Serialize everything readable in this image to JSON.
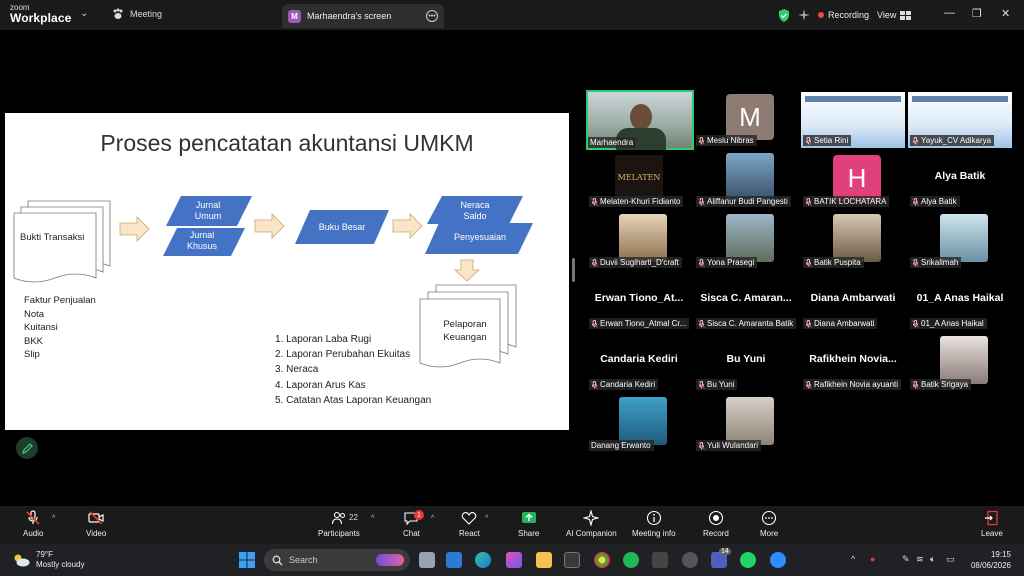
{
  "app": {
    "brand_top": "zoom",
    "brand_bottom": "Workplace",
    "meeting_tab": "Meeting",
    "screen_tab": "Marhaendra's screen",
    "screen_tab_badge": "M",
    "recording_label": "Recording",
    "view_label": "View"
  },
  "slide": {
    "title": "Proses pencatatan akuntansi UMKM",
    "doc_stack_label": "Bukti Transaksi",
    "left_list": [
      "Faktur Penjualan",
      "Nota",
      "Kuitansi",
      "BKK",
      "Slip"
    ],
    "jurnal_umum": [
      "Jurnal",
      "Umum"
    ],
    "jurnal_khusus": [
      "Jurnal",
      "Khusus"
    ],
    "buku_besar": "Buku Besar",
    "neraca_saldo": [
      "Neraca",
      "Saldo"
    ],
    "penyesuaian": "Penyesuaian",
    "pelaporan": [
      "Pelaporan",
      "Keuangan"
    ],
    "report_list": [
      "1. Laporan Laba Rugi",
      "2. Laporan Perubahan Ekuitas",
      "3. Neraca",
      "4. Laporan Arus Kas",
      "5. Catatan Atas Laporan Keuangan"
    ],
    "colors": {
      "shape_blue": "#4472c4",
      "arrow_fill": "#fbe5c8",
      "arrow_stroke": "#c9a66b"
    }
  },
  "gallery": [
    {
      "name": "Marhaendra",
      "kind": "video",
      "muted": false,
      "active": true
    },
    {
      "name": "Meslu Nibras",
      "kind": "letter",
      "letter": "M",
      "color": "#8e7b73",
      "muted": true
    },
    {
      "name": "Setia Rini",
      "kind": "banner",
      "muted": true
    },
    {
      "name": "Yayuk_CV Adikarya",
      "kind": "banner",
      "muted": true
    },
    {
      "name": "Melaten-Khuri Fidianto",
      "kind": "logo",
      "logo_text": "MELATEN",
      "muted": true
    },
    {
      "name": "Aliffanur Budi Pangesti",
      "kind": "photo",
      "muted": true
    },
    {
      "name": "BATIK LOCHATARA",
      "kind": "letter",
      "letter": "H",
      "color": "#e0417a",
      "muted": true
    },
    {
      "name": "Alya Batik",
      "kind": "name",
      "big": "Alya Batik",
      "muted": true
    },
    {
      "name": "Duvii Sugiharti_D'craft",
      "kind": "photo",
      "muted": true
    },
    {
      "name": "Yona Prasegi",
      "kind": "photo",
      "muted": true
    },
    {
      "name": "Batik Puspita",
      "kind": "photo",
      "muted": true
    },
    {
      "name": "Srikalimah",
      "kind": "photo",
      "muted": true
    },
    {
      "name": "Erwan Tiono_Atmal Cr...",
      "kind": "name",
      "big": "Erwan  Tiono_At...",
      "muted": true
    },
    {
      "name": "Sisca C. Amaranta Batik",
      "kind": "name",
      "big": "Sisca C. Amaran...",
      "muted": true
    },
    {
      "name": "Diana Ambarwati",
      "kind": "name",
      "big": "Diana Ambarwati",
      "muted": true
    },
    {
      "name": "01_A Anas Haikal",
      "kind": "name",
      "big": "01_A Anas Haikal",
      "muted": true
    },
    {
      "name": "Candaria Kediri",
      "kind": "name",
      "big": "Candaria Kediri",
      "muted": true
    },
    {
      "name": "Bu Yuni",
      "kind": "name",
      "big": "Bu Yuni",
      "muted": true
    },
    {
      "name": "Rafikhein Novia ayuanti",
      "kind": "name",
      "big": "Rafikhein  Novia...",
      "muted": true
    },
    {
      "name": "Batik Srigaya",
      "kind": "photo",
      "muted": true
    },
    {
      "name": "Danang Erwanto",
      "kind": "photo",
      "muted": false
    },
    {
      "name": "Yuli Wulandari",
      "kind": "photo",
      "muted": true
    }
  ],
  "toolbar": {
    "audio": "Audio",
    "video": "Video",
    "participants": "Participants",
    "participants_count": "22",
    "chat": "Chat",
    "chat_badge": "1",
    "react": "React",
    "share": "Share",
    "ai_companion": "AI Companion",
    "meeting_info": "Meeting info",
    "record": "Record",
    "more": "More",
    "leave": "Leave"
  },
  "taskbar": {
    "temp": "79°F",
    "weather": "Mostly cloudy",
    "search": "Search",
    "time": "19:15",
    "date": "08/06/2026",
    "teams_badge": "14"
  }
}
